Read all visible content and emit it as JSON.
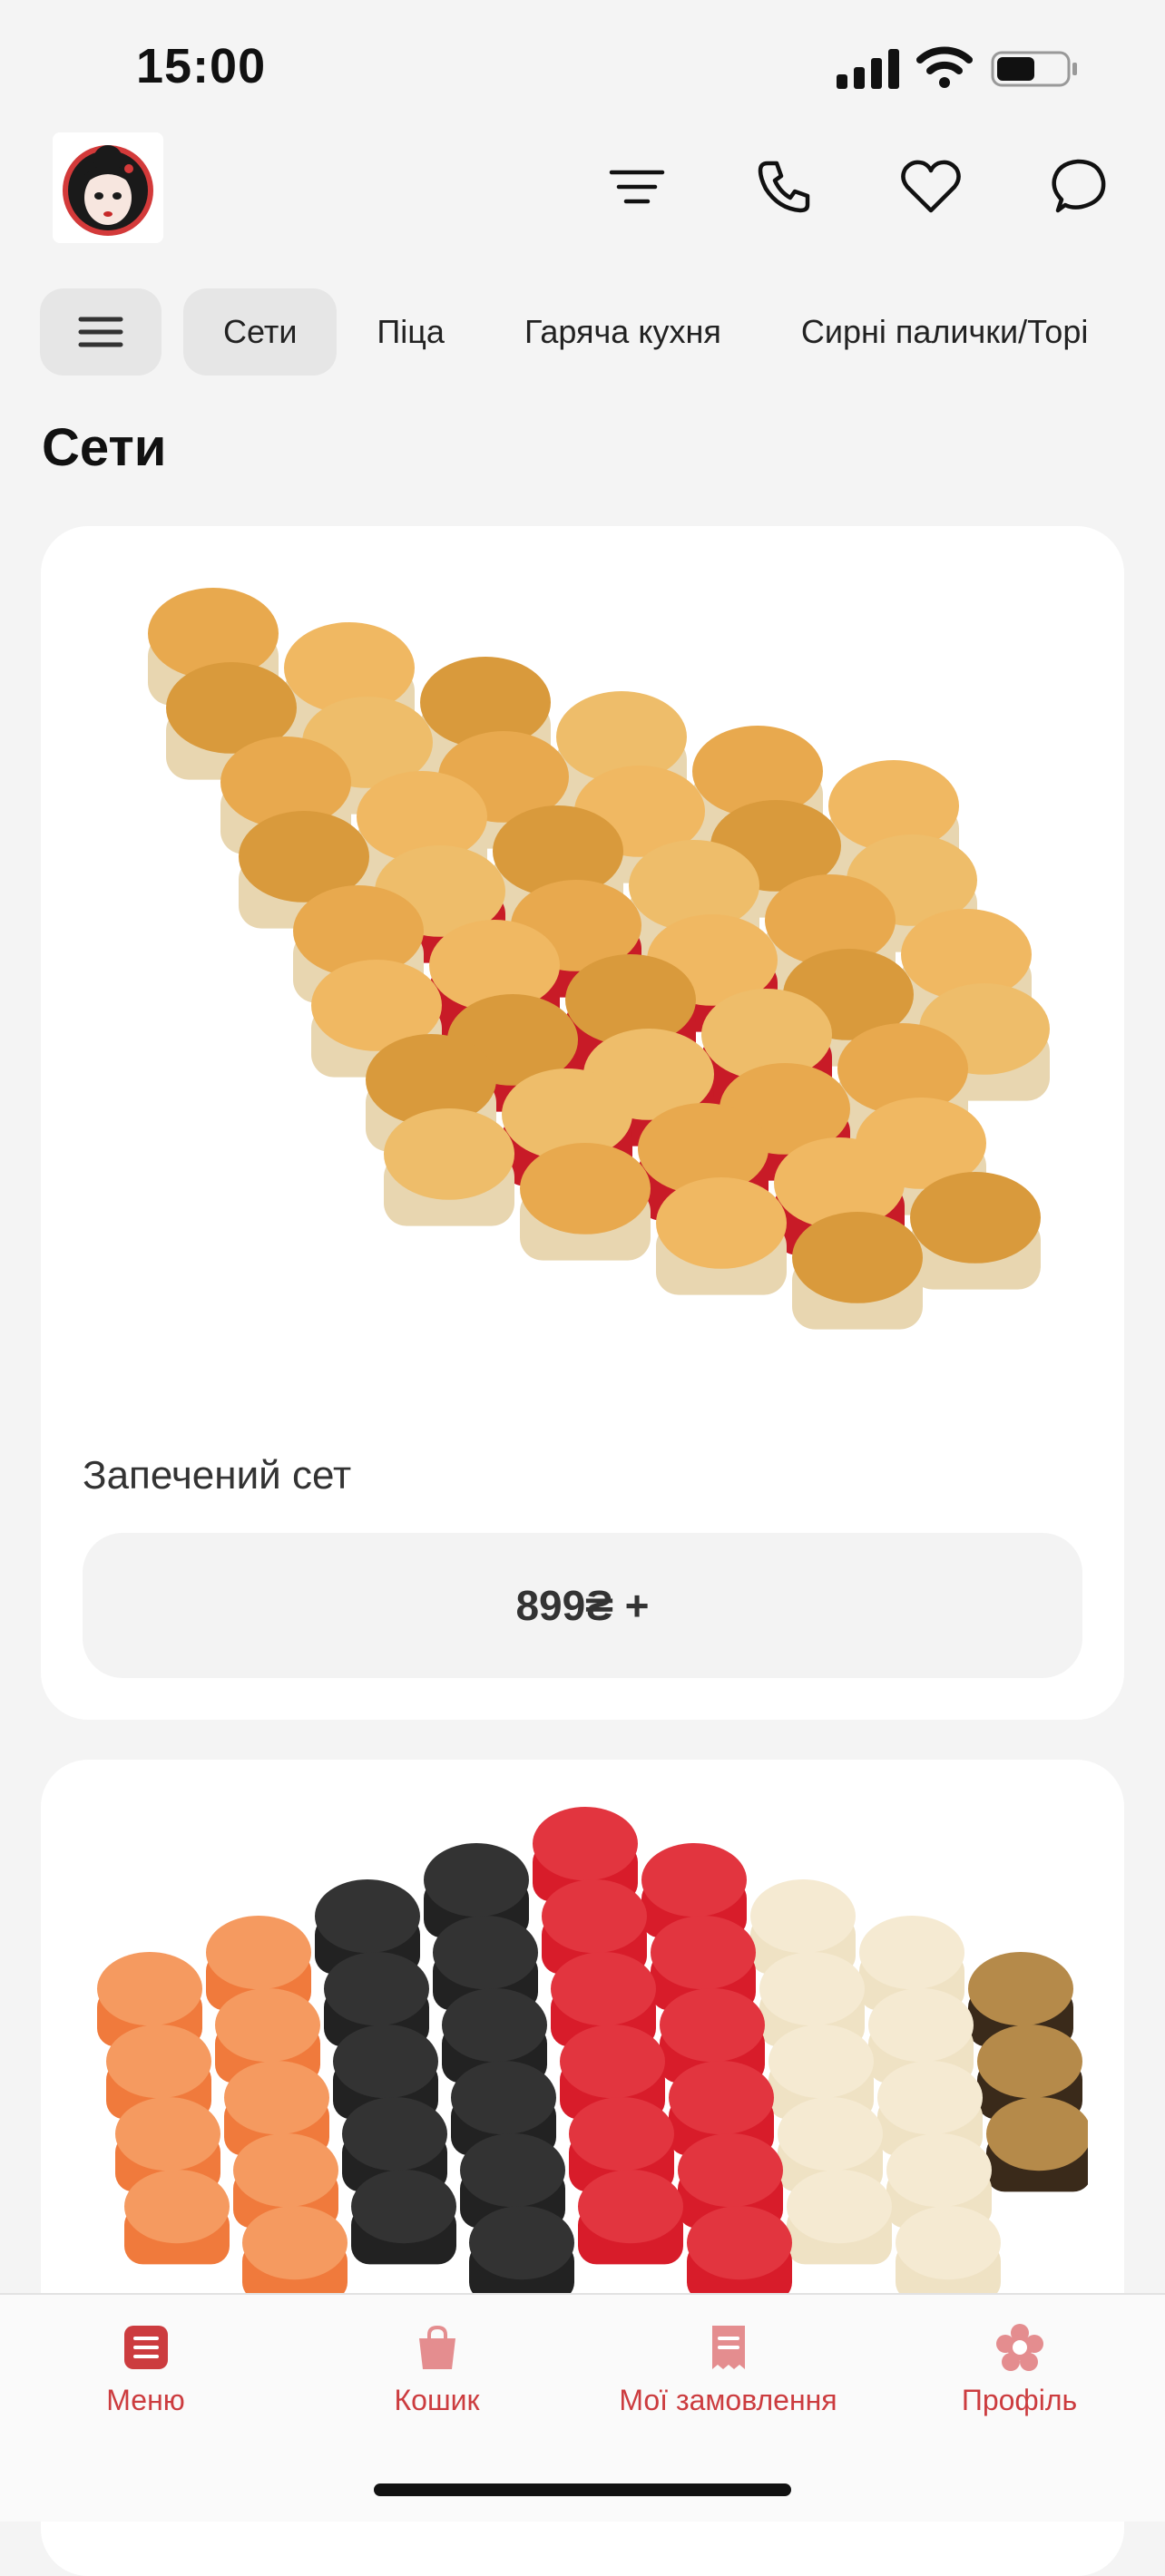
{
  "status_bar": {
    "time": "15:00",
    "battery_level": 0.55
  },
  "header": {
    "icons": [
      "logo-icon",
      "filter-icon",
      "phone-icon",
      "heart-icon",
      "chat-icon"
    ]
  },
  "categories": {
    "items": [
      "Сети",
      "Піца",
      "Гаряча кухня",
      "Сирні палички/Торі"
    ],
    "active": "Сети"
  },
  "section": {
    "title": "Сети"
  },
  "products": [
    {
      "name": "Запечений сет",
      "price": "899₴ +"
    }
  ],
  "tabbar": {
    "items": [
      {
        "label": "Меню",
        "icon": "menu-icon"
      },
      {
        "label": "Кошик",
        "icon": "bag-icon"
      },
      {
        "label": "Мої замовлення",
        "icon": "receipt-icon"
      },
      {
        "label": "Профіль",
        "icon": "flower-icon"
      }
    ]
  },
  "colors": {
    "accent": "#cc3c3f",
    "background": "#f4f4f4",
    "card": "#ffffff",
    "chip": "#e6e6e6"
  }
}
